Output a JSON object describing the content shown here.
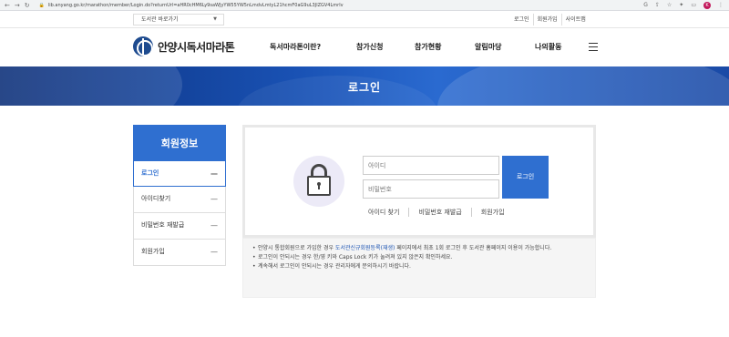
{
  "browser": {
    "url": "lib.anyang.go.kr/marathon/member/Login.do?returnUrl=aHR0cHM6Ly9saWJyYW55YW5nLmdvLmtyL21hcmF0aG9uL3JlZGV4Lmrlv",
    "avatar": "K"
  },
  "util": {
    "library_select": "도서관 바로가기",
    "links": [
      "로그인",
      "회원가입",
      "사이트맵"
    ]
  },
  "header": {
    "logo_text": "안양시독서마라톤",
    "menu": [
      "독서마라톤이란?",
      "참가신청",
      "참가현황",
      "알림마당",
      "나의활동"
    ]
  },
  "banner": {
    "title": "로그인"
  },
  "sidebar": {
    "title": "회원정보",
    "items": [
      {
        "label": "로그인"
      },
      {
        "label": "아이디찾기"
      },
      {
        "label": "비밀번호 재발급"
      },
      {
        "label": "회원가입"
      }
    ],
    "dash": "—"
  },
  "login": {
    "id_placeholder": "아이디",
    "pw_placeholder": "비밀번호",
    "button": "로그인",
    "links": [
      "아이디 찾기",
      "비밀번호 재발급",
      "회원가입"
    ]
  },
  "notes": {
    "line1_pre": "안양시 통합회원으로 가입한 경우 ",
    "line1_link": "도서관신규회원등록(재생)",
    "line1_post": " 페이지에서 최초 1회 로그인 후 도서관 홈페이지 이용이 가능합니다.",
    "line2": "로그인이 안되시는 경우 한/영 키와 Caps Lock 키가 눌려져 있지 않은지 확인하세요.",
    "line3": "계속해서 로그인이 안되시는 경우 관리자에게 문의하시기 바랍니다."
  },
  "colors": {
    "primary": "#2f6fd0",
    "banner_dark": "#0b2e78",
    "lock_bg": "#eceaf7"
  }
}
